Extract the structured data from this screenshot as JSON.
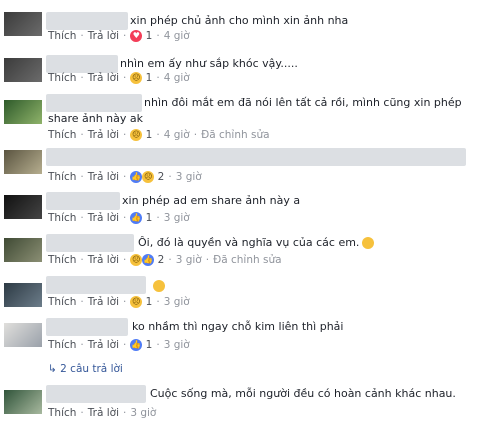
{
  "actions": {
    "like": "Thích",
    "reply": "Trả lời",
    "edited": "Đã chỉnh sửa",
    "sep": "·"
  },
  "comments": [
    {
      "text": "xin phép chủ ảnh cho mình xin ảnh nha",
      "count": "1",
      "time": "4 giờ",
      "reaction": "heart-icon"
    },
    {
      "text": "nhìn em ấy như sắp khóc vậy.....",
      "count": "1",
      "time": "4 giờ",
      "reaction": "sad-icon"
    },
    {
      "text": "nhìn đôi mắt em đã nói lên tất cả rồi, mình cũng xin phép",
      "text2": "share ảnh này ak",
      "count": "1",
      "time": "4 giờ",
      "reaction": "sad-icon"
    },
    {
      "text": "",
      "count": "2",
      "time": "3 giờ",
      "reaction": "like-sad-icon"
    },
    {
      "text": "xin phép ad em share ảnh này a",
      "count": "1",
      "time": "3 giờ",
      "reaction": "like-icon"
    },
    {
      "text": "Ôi, đó là quyền và nghĩa vụ của các em.",
      "count": "2",
      "time": "3 giờ",
      "reaction": "sad-like-icon"
    },
    {
      "text": "",
      "count": "1",
      "time": "3 giờ",
      "reaction": "sad-icon"
    },
    {
      "text": "ko nhầm thì ngay chỗ kim liên thì phải",
      "count": "1",
      "time": "3 giờ",
      "reaction": "like-icon"
    },
    {
      "text": "Cuộc sống mà, mỗi người đều có hoàn cảnh khác nhau.",
      "count": "",
      "time": "3 giờ",
      "reaction": ""
    }
  ],
  "replies_link": "2 câu trả lời"
}
